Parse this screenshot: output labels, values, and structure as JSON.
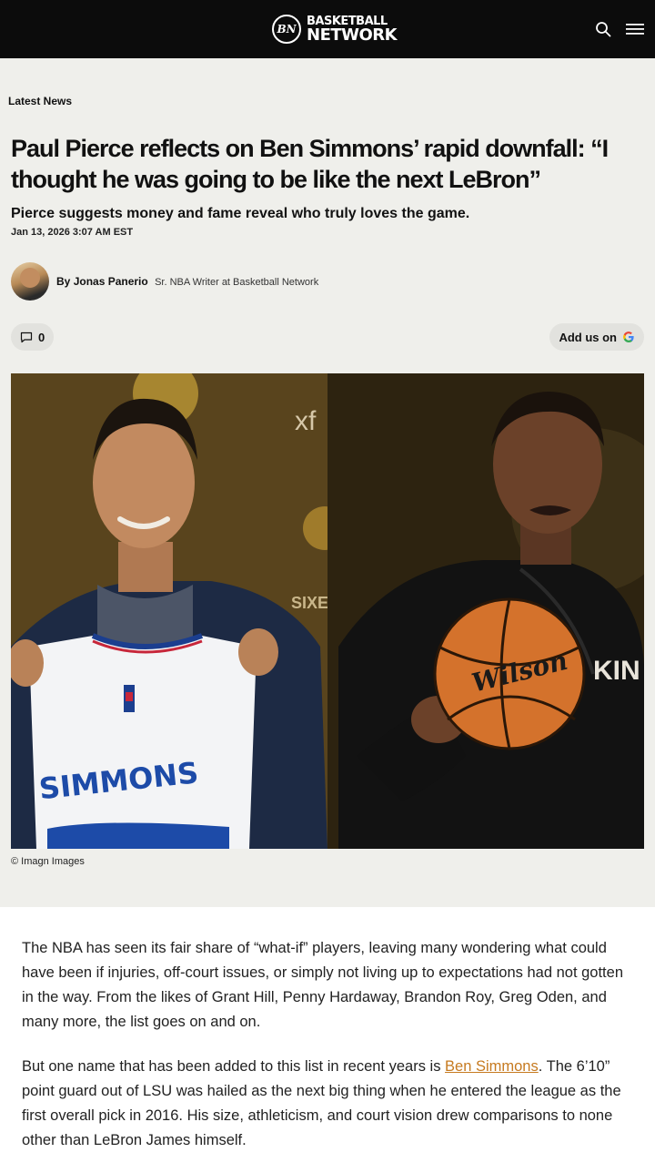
{
  "header": {
    "logo_badge": "BN",
    "logo_line1": "BASKETBALL",
    "logo_line2": "NETWORK",
    "icons": [
      "search-icon",
      "menu-icon"
    ]
  },
  "article": {
    "category": "Latest News",
    "headline": "Paul Pierce reflects on Ben Simmons’ rapid downfall: “I thought he was going to be like the next LeBron”",
    "dek": "Pierce suggests money and fame reveal who truly loves the game.",
    "date": "Jan 13, 2026 3:07 AM EST",
    "byline_prefix": "By",
    "author_name": "Jonas Panerio",
    "author_title": "Sr. NBA Writer at Basketball Network",
    "comments_count": "0",
    "add_us_label": "Add us on",
    "image_credit": "© Imagn Images",
    "image_texts": {
      "jersey_name": "SIMMONS",
      "backdrop_left": "xf",
      "backdrop_sixers": "SIXE",
      "ball_brand": "Wilson",
      "shirt_text": "KIN"
    },
    "paragraph1": "The NBA has seen its fair share of “what-if” players, leaving many wondering what could have been if injuries, off-court issues, or simply not living up to expectations had not gotten in the way. From the likes of Grant Hill, Penny Hardaway, Brandon Roy, Greg Oden, and many more, the list goes on and on.",
    "paragraph2_before": "But one name that has been added to this list in recent years is ",
    "paragraph2_link": "Ben Simmons",
    "paragraph2_after": ". The 6’10” point guard out of LSU was hailed as the next big thing when he entered the league as the first overall pick in 2016. His size, athleticism, and court vision drew comparisons to none other than LeBron James himself."
  },
  "colors": {
    "topbar": "#0c0c0c",
    "header_bg": "#efefeb",
    "link": "#c67a20"
  }
}
